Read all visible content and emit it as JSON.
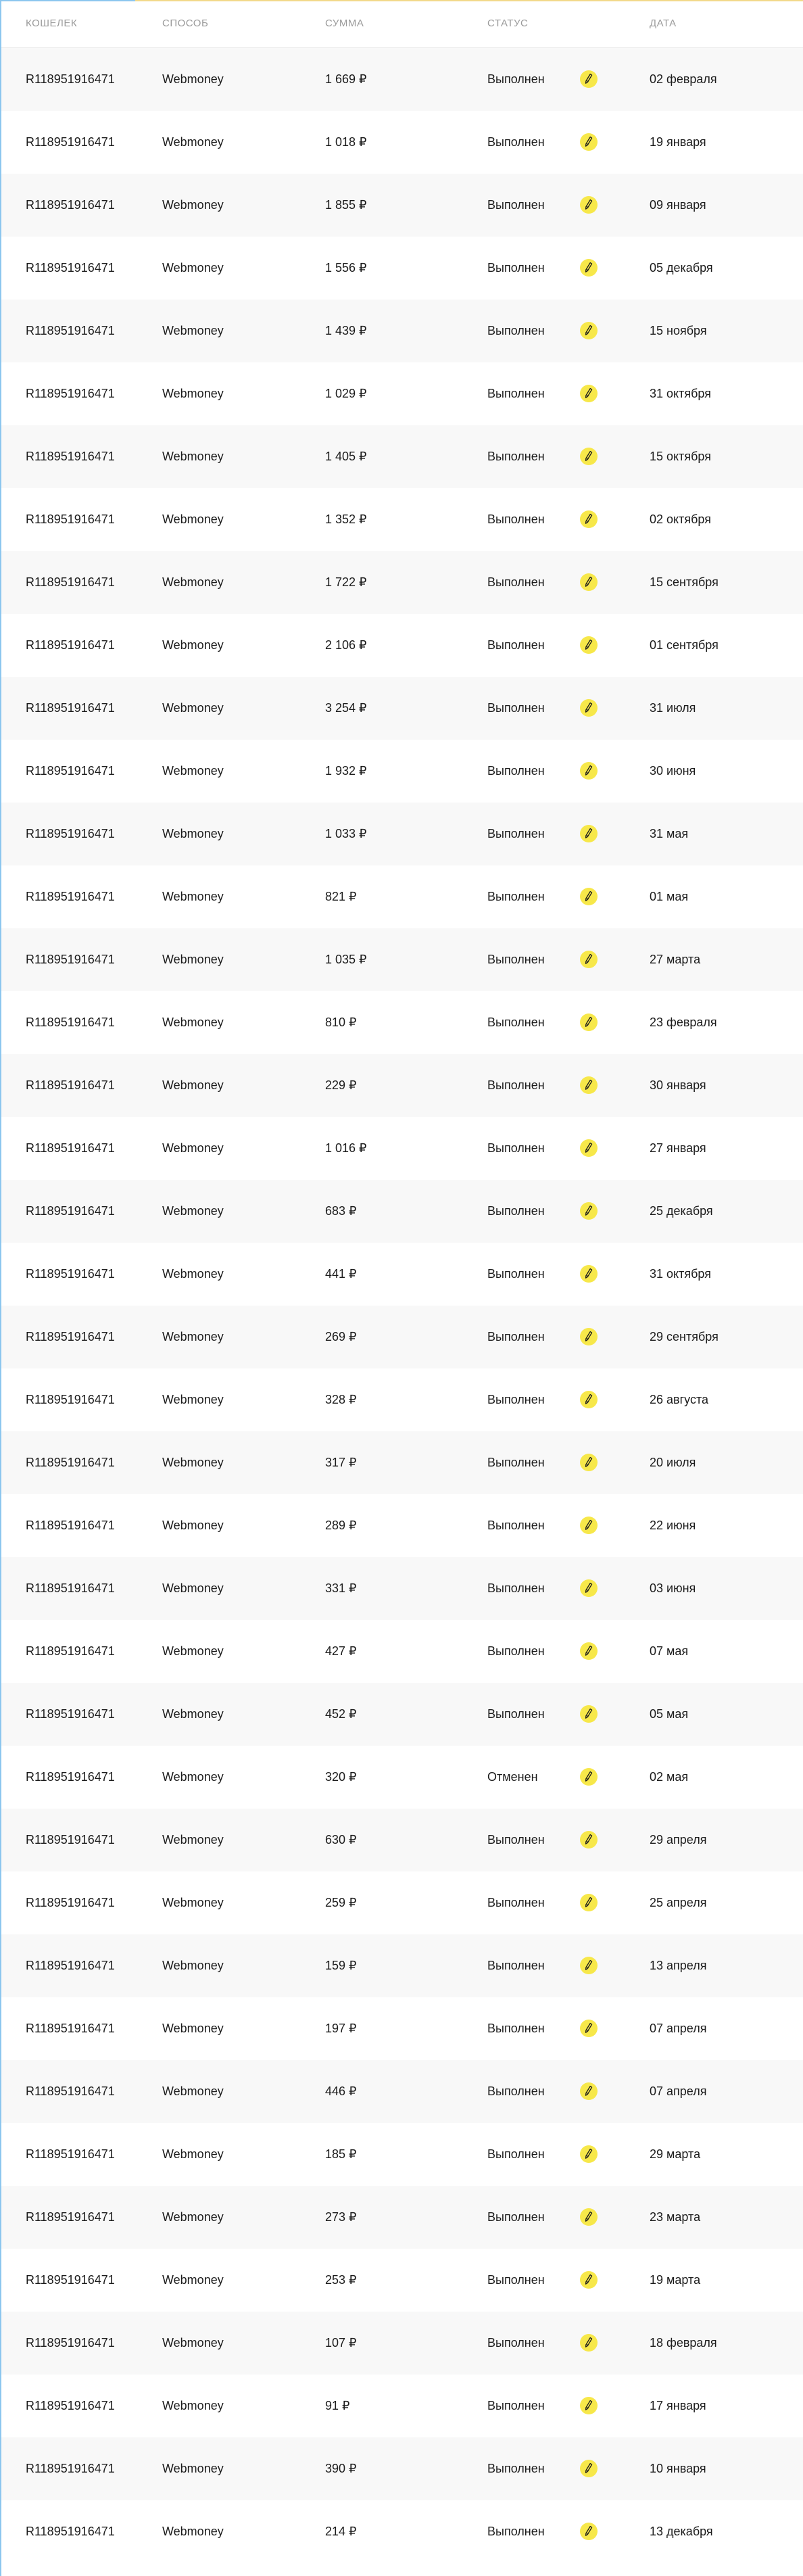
{
  "table": {
    "headers": {
      "wallet": "КОШЕЛЕК",
      "method": "СПОСОБ",
      "sum": "СУММА",
      "status": "СТАТУС",
      "date": "ДАТА"
    },
    "status_icon": "info-pencil-icon",
    "accent_colors": {
      "icon_bg": "#f7e84a",
      "frame_left": "#8cc6ee",
      "frame_top": "#f2d98a"
    },
    "rows": [
      {
        "wallet": "R118951916471",
        "method": "Webmoney",
        "sum": "1 669 ₽",
        "status": "Выполнен",
        "date": "02 февраля"
      },
      {
        "wallet": "R118951916471",
        "method": "Webmoney",
        "sum": "1 018 ₽",
        "status": "Выполнен",
        "date": "19 января"
      },
      {
        "wallet": "R118951916471",
        "method": "Webmoney",
        "sum": "1 855 ₽",
        "status": "Выполнен",
        "date": "09 января"
      },
      {
        "wallet": "R118951916471",
        "method": "Webmoney",
        "sum": "1 556 ₽",
        "status": "Выполнен",
        "date": "05 декабря"
      },
      {
        "wallet": "R118951916471",
        "method": "Webmoney",
        "sum": "1 439 ₽",
        "status": "Выполнен",
        "date": "15 ноября"
      },
      {
        "wallet": "R118951916471",
        "method": "Webmoney",
        "sum": "1 029 ₽",
        "status": "Выполнен",
        "date": "31 октября"
      },
      {
        "wallet": "R118951916471",
        "method": "Webmoney",
        "sum": "1 405 ₽",
        "status": "Выполнен",
        "date": "15 октября"
      },
      {
        "wallet": "R118951916471",
        "method": "Webmoney",
        "sum": "1 352 ₽",
        "status": "Выполнен",
        "date": "02 октября"
      },
      {
        "wallet": "R118951916471",
        "method": "Webmoney",
        "sum": "1 722 ₽",
        "status": "Выполнен",
        "date": "15 сентября"
      },
      {
        "wallet": "R118951916471",
        "method": "Webmoney",
        "sum": "2 106 ₽",
        "status": "Выполнен",
        "date": "01 сентября"
      },
      {
        "wallet": "R118951916471",
        "method": "Webmoney",
        "sum": "3 254 ₽",
        "status": "Выполнен",
        "date": "31 июля"
      },
      {
        "wallet": "R118951916471",
        "method": "Webmoney",
        "sum": "1 932 ₽",
        "status": "Выполнен",
        "date": "30 июня"
      },
      {
        "wallet": "R118951916471",
        "method": "Webmoney",
        "sum": "1 033 ₽",
        "status": "Выполнен",
        "date": "31 мая"
      },
      {
        "wallet": "R118951916471",
        "method": "Webmoney",
        "sum": "821 ₽",
        "status": "Выполнен",
        "date": "01 мая"
      },
      {
        "wallet": "R118951916471",
        "method": "Webmoney",
        "sum": "1 035 ₽",
        "status": "Выполнен",
        "date": "27 марта"
      },
      {
        "wallet": "R118951916471",
        "method": "Webmoney",
        "sum": "810 ₽",
        "status": "Выполнен",
        "date": "23 февраля"
      },
      {
        "wallet": "R118951916471",
        "method": "Webmoney",
        "sum": "229 ₽",
        "status": "Выполнен",
        "date": "30 января"
      },
      {
        "wallet": "R118951916471",
        "method": "Webmoney",
        "sum": "1 016 ₽",
        "status": "Выполнен",
        "date": "27 января"
      },
      {
        "wallet": "R118951916471",
        "method": "Webmoney",
        "sum": "683 ₽",
        "status": "Выполнен",
        "date": "25 декабря"
      },
      {
        "wallet": "R118951916471",
        "method": "Webmoney",
        "sum": "441 ₽",
        "status": "Выполнен",
        "date": "31 октября"
      },
      {
        "wallet": "R118951916471",
        "method": "Webmoney",
        "sum": "269 ₽",
        "status": "Выполнен",
        "date": "29 сентября"
      },
      {
        "wallet": "R118951916471",
        "method": "Webmoney",
        "sum": "328 ₽",
        "status": "Выполнен",
        "date": "26 августа"
      },
      {
        "wallet": "R118951916471",
        "method": "Webmoney",
        "sum": "317 ₽",
        "status": "Выполнен",
        "date": "20 июля"
      },
      {
        "wallet": "R118951916471",
        "method": "Webmoney",
        "sum": "289 ₽",
        "status": "Выполнен",
        "date": "22 июня"
      },
      {
        "wallet": "R118951916471",
        "method": "Webmoney",
        "sum": "331 ₽",
        "status": "Выполнен",
        "date": "03 июня"
      },
      {
        "wallet": "R118951916471",
        "method": "Webmoney",
        "sum": "427 ₽",
        "status": "Выполнен",
        "date": "07 мая"
      },
      {
        "wallet": "R118951916471",
        "method": "Webmoney",
        "sum": "452 ₽",
        "status": "Выполнен",
        "date": "05 мая"
      },
      {
        "wallet": "R118951916471",
        "method": "Webmoney",
        "sum": "320 ₽",
        "status": "Отменен",
        "date": "02 мая"
      },
      {
        "wallet": "R118951916471",
        "method": "Webmoney",
        "sum": "630 ₽",
        "status": "Выполнен",
        "date": "29 апреля"
      },
      {
        "wallet": "R118951916471",
        "method": "Webmoney",
        "sum": "259 ₽",
        "status": "Выполнен",
        "date": "25 апреля"
      },
      {
        "wallet": "R118951916471",
        "method": "Webmoney",
        "sum": "159 ₽",
        "status": "Выполнен",
        "date": "13 апреля"
      },
      {
        "wallet": "R118951916471",
        "method": "Webmoney",
        "sum": "197 ₽",
        "status": "Выполнен",
        "date": "07 апреля"
      },
      {
        "wallet": "R118951916471",
        "method": "Webmoney",
        "sum": "446 ₽",
        "status": "Выполнен",
        "date": "07 апреля"
      },
      {
        "wallet": "R118951916471",
        "method": "Webmoney",
        "sum": "185 ₽",
        "status": "Выполнен",
        "date": "29 марта"
      },
      {
        "wallet": "R118951916471",
        "method": "Webmoney",
        "sum": "273 ₽",
        "status": "Выполнен",
        "date": "23 марта"
      },
      {
        "wallet": "R118951916471",
        "method": "Webmoney",
        "sum": "253 ₽",
        "status": "Выполнен",
        "date": "19 марта"
      },
      {
        "wallet": "R118951916471",
        "method": "Webmoney",
        "sum": "107 ₽",
        "status": "Выполнен",
        "date": "18 февраля"
      },
      {
        "wallet": "R118951916471",
        "method": "Webmoney",
        "sum": "91 ₽",
        "status": "Выполнен",
        "date": "17 января"
      },
      {
        "wallet": "R118951916471",
        "method": "Webmoney",
        "sum": "390 ₽",
        "status": "Выполнен",
        "date": "10 января"
      },
      {
        "wallet": "R118951916471",
        "method": "Webmoney",
        "sum": "214 ₽",
        "status": "Выполнен",
        "date": "13 декабря"
      }
    ]
  }
}
